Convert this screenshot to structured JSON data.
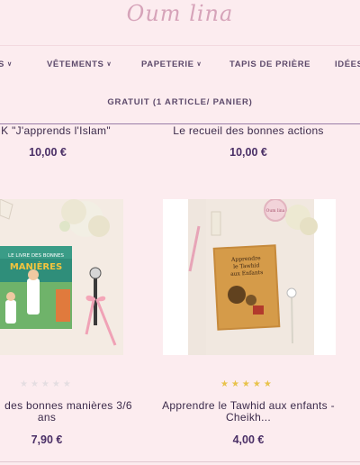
{
  "logo": {
    "text": "Oum lina"
  },
  "nav": {
    "items": [
      {
        "label": "S",
        "has_chevron": true
      },
      {
        "label": "VÊTEMENTS",
        "has_chevron": true
      },
      {
        "label": "PAPETERIE",
        "has_chevron": true
      },
      {
        "label": "TAPIS DE PRIÈRE",
        "has_chevron": false
      },
      {
        "label": "IDÉES",
        "has_chevron": false
      }
    ]
  },
  "promo": {
    "text": "GRATUIT (1 ARTICLE/ PANIER)"
  },
  "products_top": [
    {
      "title": "K \"J'apprends l'Islam\"",
      "price": "10,00 €"
    },
    {
      "title": "Le recueil des bonnes actions",
      "price": "10,00 €"
    }
  ],
  "products_bottom": [
    {
      "title_line1": "des bonnes manières 3/6",
      "title_line2": "ans",
      "price": "7,90 €",
      "rating": 0,
      "rating_max": 5,
      "book_title": "LE LIVRE DES BONNES MANIÈRES"
    },
    {
      "title_line1": "Apprendre le Tawhid aux enfants -",
      "title_line2": "Cheikh...",
      "price": "4,00 €",
      "rating": 5,
      "rating_max": 5,
      "book_title": "Apprendre le Tawhid aux Enfants"
    }
  ],
  "colors": {
    "background": "#fcecef",
    "accent_purple": "#4a2f66",
    "star_gold": "#e8c24a",
    "star_empty": "#e4dde1"
  }
}
